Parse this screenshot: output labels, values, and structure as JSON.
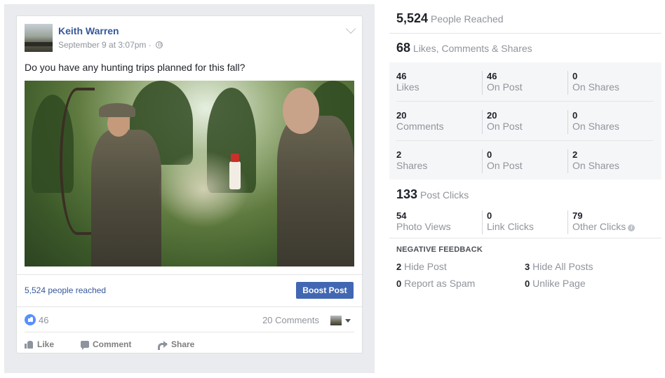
{
  "post": {
    "author": "Keith Warren",
    "timestamp": "September 9 at 3:07pm ·",
    "text": "Do you have any hunting trips planned for this fall?",
    "reach_text": "5,524 people reached",
    "boost_label": "Boost Post",
    "likes_count": "46",
    "comments_count": "20 Comments",
    "actions": {
      "like": "Like",
      "comment": "Comment",
      "share": "Share"
    }
  },
  "insights": {
    "reached": {
      "value": "5,524",
      "label": "People Reached"
    },
    "engagement": {
      "value": "68",
      "label": "Likes, Comments & Shares"
    },
    "rows": [
      {
        "total": "46",
        "total_label": "Likes",
        "on_post": "46",
        "on_post_label": "On Post",
        "on_shares": "0",
        "on_shares_label": "On Shares"
      },
      {
        "total": "20",
        "total_label": "Comments",
        "on_post": "20",
        "on_post_label": "On Post",
        "on_shares": "0",
        "on_shares_label": "On Shares"
      },
      {
        "total": "2",
        "total_label": "Shares",
        "on_post": "0",
        "on_post_label": "On Post",
        "on_shares": "2",
        "on_shares_label": "On Shares"
      }
    ],
    "post_clicks": {
      "value": "133",
      "label": "Post Clicks"
    },
    "clicks": [
      {
        "value": "54",
        "label": "Photo Views"
      },
      {
        "value": "0",
        "label": "Link Clicks"
      },
      {
        "value": "79",
        "label": "Other Clicks"
      }
    ],
    "negative_feedback": {
      "title": "NEGATIVE FEEDBACK",
      "hide_post": {
        "value": "2",
        "label": "Hide Post"
      },
      "hide_all": {
        "value": "3",
        "label": "Hide All Posts"
      },
      "report_spam": {
        "value": "0",
        "label": "Report as Spam"
      },
      "unlike_page": {
        "value": "0",
        "label": "Unlike Page"
      }
    }
  },
  "colors": {
    "link": "#365899",
    "button": "#4267b2",
    "muted": "#90949c",
    "panel_bg": "#e9ebee"
  },
  "icons": [
    "chevron-down-icon",
    "globe-icon",
    "like-badge-icon",
    "thumb-icon",
    "comment-icon",
    "share-icon",
    "info-icon",
    "dropdown-caret-icon"
  ]
}
